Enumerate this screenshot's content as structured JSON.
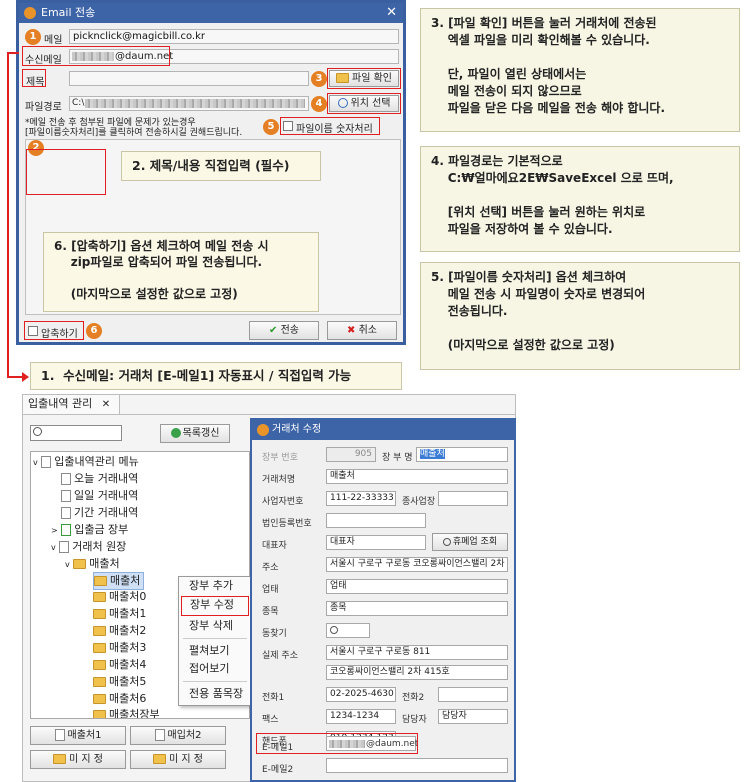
{
  "email_dialog": {
    "title": "Email 전송",
    "close_glyph": "✕",
    "mail_label": "메일",
    "mail_value": "picknclick@magicbill.co.kr",
    "recipient_label": "수신메일",
    "recipient_value": "@daum.net",
    "subject_label": "제목",
    "file_confirm_label": "파일 확인",
    "filepath_label": "파일경로",
    "filepath_value": "C:\\",
    "location_select_label": "위치 선택",
    "notice_line1": "*메일 전송 후 첨부된 파일에 문제가 있는경우",
    "notice_line2": "[파일이름숫자처리]를 클릭하여 전송하시길 권해드립니다.",
    "filename_number_label": "파일이름 숫자처리",
    "compress_label": "압축하기",
    "send_label": "전송",
    "cancel_label": "취소",
    "badges": [
      "1",
      "2",
      "3",
      "4",
      "5",
      "6"
    ]
  },
  "callouts": {
    "c2": "2. 제목/내용 직접입력 (필수)",
    "c6": "6. [압축하기] 옵션 체크하여 메일 전송 시\n    zip파일로 압축되어 파일 전송됩니다.\n\n    (마지막으로 설정한 값으로 고정)",
    "c1": "1.  수신메일: 거래처 [E-메일1] 자동표시 / 직접입력 가능",
    "n3": "3. [파일 확인] 버튼을 눌러 거래처에 전송된\n    엑셀 파일을 미리 확인해볼 수 있습니다.\n\n    단, 파일이 열린 상태에서는\n    메일 전송이 되지 않으므로\n    파일을 닫은 다음 메일을 전송 해야 합니다.",
    "n4": "4. 파일경로는 기본적으로\n    C:₩얼마에요2E₩SaveExcel 으로 뜨며,\n\n    [위치 선택] 버튼을 눌러 원하는 위치로\n    파일을 저장하여 볼 수 있습니다.",
    "n5": "5. [파일이름 숫자처리] 옵션 체크하여\n    메일 전송 시 파일명이 숫자로 변경되어\n    전송됩니다.\n\n    (마지막으로 설정한 값으로 고정)"
  },
  "main_panel": {
    "tab_label": "입출내역 관리",
    "tab_close": "✕",
    "search_value": "",
    "refresh_label": "목록갱신",
    "tree": {
      "root": "입출내역관리 메뉴",
      "today": "오늘 거래내역",
      "daily": "일일 거래내역",
      "period": "기간 거래내역",
      "ledger": "입출금 장부",
      "client_ledger": "거래처 원장",
      "group": "매출처",
      "items": [
        "매출처",
        "매출처0",
        "매출처1",
        "매출처2",
        "매출처3",
        "매출처4",
        "매출처5",
        "매출처6",
        "매출처장부"
      ]
    },
    "context_menu": [
      "장부 추가",
      "장부 수정",
      "장부 삭제",
      "펼쳐보기",
      "접어보기",
      "전용 품목장"
    ],
    "bottom_buttons": [
      "매출처1",
      "매입처2",
      "미 지 정",
      "미 지 정"
    ]
  },
  "client_dialog": {
    "title": "거래처 수정",
    "ledger_no_label": "장부 번호",
    "ledger_no_value": "905",
    "ledger_name_label": "장 부 명",
    "ledger_name_value": "매출처",
    "client_name_label": "거래처명",
    "client_name_value": "매출처",
    "biz_no_label": "사업자번호",
    "biz_no_value": "111-22-33333",
    "branch_label": "종사업장",
    "corp_no_label": "법인등록번호",
    "rep_label": "대표자",
    "rep_value": "대표자",
    "closure_label": "휴폐업 조회",
    "address_label": "주소",
    "address_value": "서울시 구로구 구로동 코오롱싸이언스밸리 2차 4",
    "biz_type_label": "업태",
    "biz_type_value": "업태",
    "item_label": "종목",
    "item_value": "종목",
    "sync_label": "동찾기",
    "real_addr_label": "실제 주소",
    "real_addr_value": "서울시 구로구 구로동 811",
    "real_addr2_value": "코오롱싸이언스밸리 2차 415호",
    "phone1_label": "전화1",
    "phone1_value": "02-2025-4630",
    "phone2_label": "전화2",
    "fax_label": "팩스",
    "fax_value": "1234-1234",
    "manager_label": "담당자",
    "manager_value": "담당자",
    "mobile_label": "핸드폰",
    "mobile_value": "010-1234-1234",
    "email1_label": "E-메일1",
    "email1_value": "@daum.net",
    "email2_label": "E-메일2"
  }
}
